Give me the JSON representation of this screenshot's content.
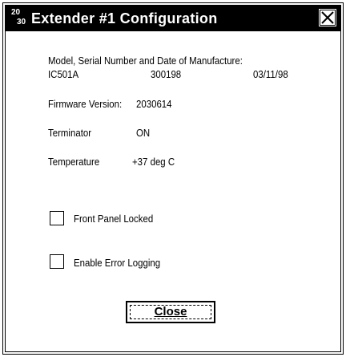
{
  "window": {
    "title": "Extender #1 Configuration",
    "icon_label_top": "20",
    "icon_label_bottom": "30",
    "close_icon": "close-x-icon"
  },
  "info": {
    "model_header": "Model, Serial Number and Date of Manufacture:",
    "model": "IC501A",
    "serial": "300198",
    "date": "03/11/98",
    "firmware_label": "Firmware Version:",
    "firmware_value": "2030614",
    "terminator_label": "Terminator",
    "terminator_value": "ON",
    "temperature_label": "Temperature",
    "temperature_value": "+37 deg C"
  },
  "options": {
    "front_panel_locked": {
      "label": "Front Panel Locked",
      "checked": false
    },
    "enable_error_logging": {
      "label": "Enable Error Logging",
      "checked": false
    }
  },
  "buttons": {
    "close_label": "Close"
  }
}
